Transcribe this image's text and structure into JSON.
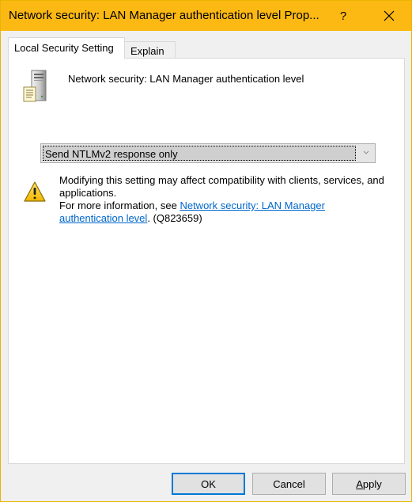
{
  "window": {
    "title": "Network security: LAN Manager authentication level Prop...",
    "help_label": "?",
    "accent_color": "#fcb914"
  },
  "tabs": [
    {
      "label": "Local Security Setting",
      "active": true
    },
    {
      "label": "Explain",
      "active": false
    }
  ],
  "policy": {
    "icon": "server-icon",
    "name": "Network security: LAN Manager authentication level"
  },
  "setting": {
    "selected_value": "Send NTLMv2 response only"
  },
  "warning": {
    "icon": "warning-icon",
    "line1": "Modifying this setting may affect compatibility with clients, services, and applications.",
    "more_info_prefix": "For more information, see ",
    "link_text": "Network security: LAN Manager authentication level",
    "suffix": ". (Q823659)",
    "link_color": "#0066cc"
  },
  "buttons": {
    "ok": "OK",
    "cancel": "Cancel",
    "apply_underlined": "A",
    "apply_rest": "pply"
  }
}
